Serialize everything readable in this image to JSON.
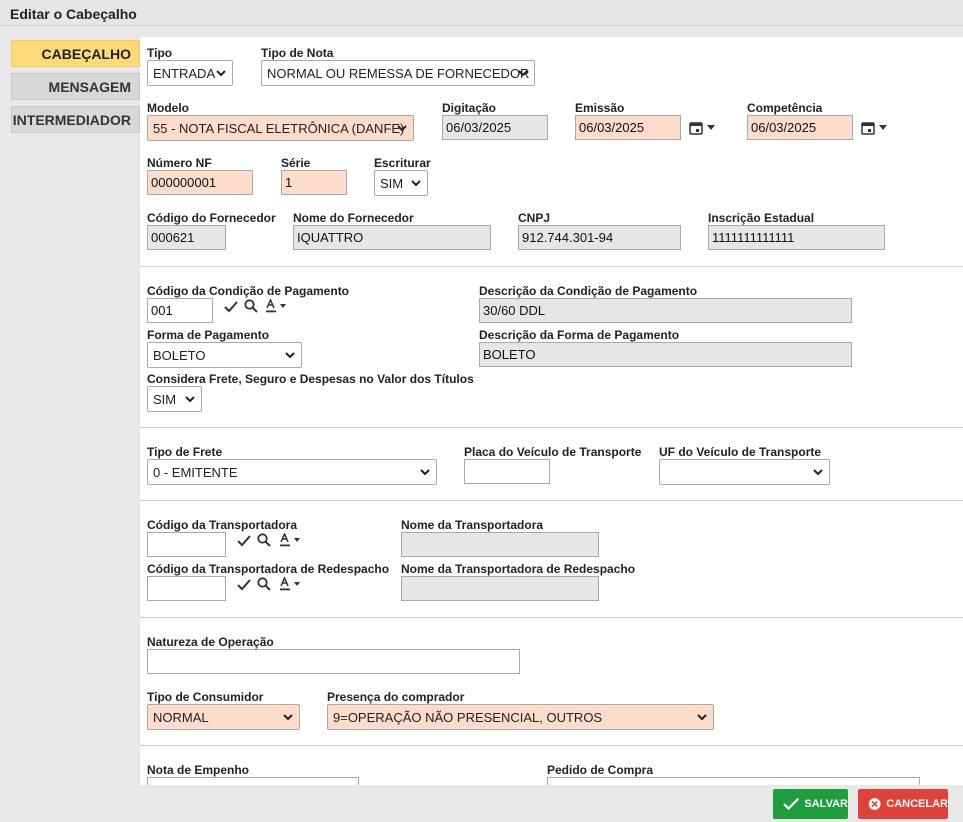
{
  "window": {
    "title": "Editar o Cabeçalho"
  },
  "nav": {
    "items": [
      {
        "label": "CABEÇALHO",
        "active": true
      },
      {
        "label": "MENSAGEM",
        "active": false
      },
      {
        "label": "INTERMEDIADOR",
        "active": false
      }
    ]
  },
  "form": {
    "tipo": {
      "label": "Tipo",
      "value": "ENTRADA"
    },
    "tipo_nota": {
      "label": "Tipo de Nota",
      "value": "NORMAL OU REMESSA DE FORNECEDOR"
    },
    "modelo": {
      "label": "Modelo",
      "value": "55 - NOTA FISCAL ELETRÔNICA (DANFE)"
    },
    "digitacao": {
      "label": "Digitação",
      "value": "06/03/2025"
    },
    "emissao": {
      "label": "Emissão",
      "value": "06/03/2025"
    },
    "competencia": {
      "label": "Competência",
      "value": "06/03/2025"
    },
    "numero_nf": {
      "label": "Número NF",
      "value": "000000001"
    },
    "serie": {
      "label": "Série",
      "value": "1"
    },
    "escriturar": {
      "label": "Escriturar",
      "value": "SIM"
    },
    "cod_fornecedor": {
      "label": "Código do Fornecedor",
      "value": "000621"
    },
    "nome_fornecedor": {
      "label": "Nome do Fornecedor",
      "value": "IQUATTRO"
    },
    "cnpj": {
      "label": "CNPJ",
      "value": "912.744.301-94"
    },
    "inscricao": {
      "label": "Inscrição Estadual",
      "value": "1111111111111"
    },
    "cod_cond_pag": {
      "label": "Código da Condição de Pagamento",
      "value": "001"
    },
    "desc_cond_pag": {
      "label": "Descrição da Condição de Pagamento",
      "value": "30/60 DDL"
    },
    "forma_pag": {
      "label": "Forma de Pagamento",
      "value": "BOLETO"
    },
    "desc_forma_pag": {
      "label": "Descrição da Forma de Pagamento",
      "value": "BOLETO"
    },
    "considera_frete": {
      "label": "Considera Frete, Seguro e Despesas no Valor dos Títulos",
      "value": "SIM"
    },
    "tipo_frete": {
      "label": "Tipo de Frete",
      "value": "0 - EMITENTE"
    },
    "placa": {
      "label": "Placa do Veículo de Transporte",
      "value": ""
    },
    "uf_veiculo": {
      "label": "UF do Veículo de Transporte",
      "value": ""
    },
    "cod_transp": {
      "label": "Código da Transportadora",
      "value": ""
    },
    "nome_transp": {
      "label": "Nome da Transportadora",
      "value": ""
    },
    "cod_transp_redesp": {
      "label": "Código da Transportadora de Redespacho",
      "value": ""
    },
    "nome_transp_redesp": {
      "label": "Nome da Transportadora de Redespacho",
      "value": ""
    },
    "natureza": {
      "label": "Natureza de Operação",
      "value": ""
    },
    "tipo_consumidor": {
      "label": "Tipo de Consumidor",
      "value": "NORMAL"
    },
    "presenca": {
      "label": "Presença do comprador",
      "value": "9=OPERAÇÃO NÃO PRESENCIAL, OUTROS"
    },
    "nota_empenho": {
      "label": "Nota de Empenho",
      "value": ""
    },
    "pedido_compra": {
      "label": "Pedido de Compra",
      "value": ""
    }
  },
  "footer": {
    "save_label": "SALVAR",
    "cancel_label": "CANCELAR"
  },
  "colors": {
    "active_tab": "#fdd97a",
    "required_field": "#fddccb",
    "save": "#1e9e3c",
    "cancel": "#e0413b"
  }
}
